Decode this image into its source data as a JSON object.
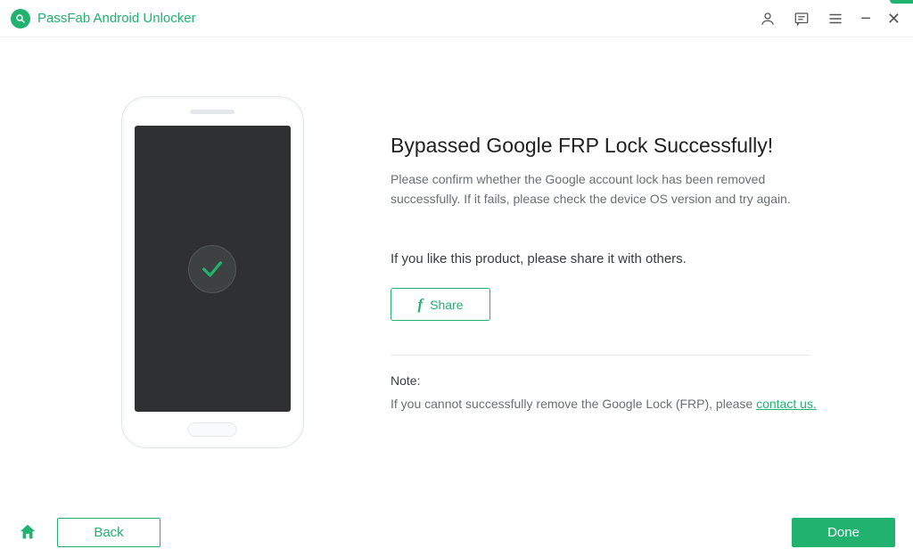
{
  "titlebar": {
    "app_name": "PassFab Android Unlocker"
  },
  "main": {
    "heading": "Bypassed Google FRP Lock Successfully!",
    "subtext": "Please confirm whether the Google account lock has been removed successfully. If it fails, please check the device OS version and try again.",
    "share_prompt": "If you like this product, please share it with others.",
    "share_button_label": "Share",
    "note_label": "Note:",
    "note_text_prefix": "If you cannot successfully remove the Google Lock (FRP), please ",
    "contact_link_label": "contact us."
  },
  "footer": {
    "back_label": "Back",
    "done_label": "Done"
  }
}
